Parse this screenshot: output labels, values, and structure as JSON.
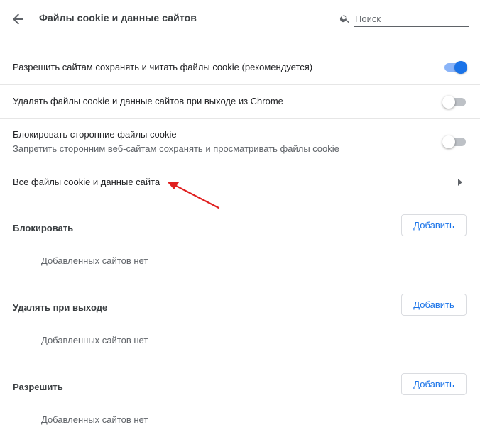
{
  "header": {
    "title": "Файлы cookie и данные сайтов",
    "search_placeholder": "Поиск"
  },
  "settings": [
    {
      "label": "Разрешить сайтам сохранять и читать файлы cookie (рекомендуется)",
      "enabled": true
    },
    {
      "label": "Удалять файлы cookie и данные сайтов при выходе из Chrome",
      "enabled": false
    },
    {
      "label": "Блокировать сторонние файлы cookie",
      "sublabel": "Запретить сторонним веб-сайтам сохранять и просматривать файлы cookie",
      "enabled": false
    }
  ],
  "all_cookies_link": {
    "label": "Все файлы cookie и данные сайта"
  },
  "sections": [
    {
      "title": "Блокировать",
      "button_label": "Добавить",
      "empty_text": "Добавленных сайтов нет"
    },
    {
      "title": "Удалять при выходе",
      "button_label": "Добавить",
      "empty_text": "Добавленных сайтов нет"
    },
    {
      "title": "Разрешить",
      "button_label": "Добавить",
      "empty_text": "Добавленных сайтов нет"
    }
  ],
  "colors": {
    "accent": "#1a73e8",
    "annotation_arrow": "#e02020"
  },
  "icons": {
    "back": "arrow-back-icon",
    "search": "search-icon",
    "chevron": "chevron-right-icon"
  }
}
